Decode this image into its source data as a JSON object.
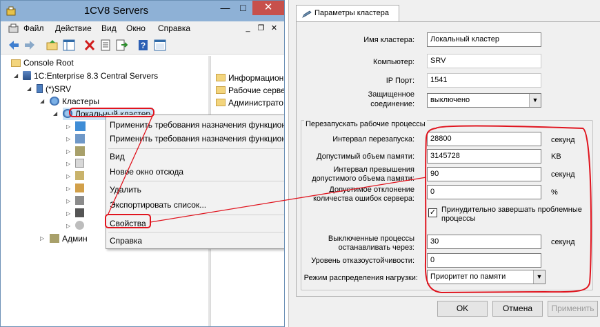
{
  "mmc": {
    "title": "1CV8 Servers",
    "menu": [
      "Файл",
      "Действие",
      "Вид",
      "Окно",
      "Справка"
    ],
    "tree": {
      "root": "Console Root",
      "servers": "1C:Enterprise 8.3 Central Servers",
      "srv": "(*)SRV",
      "clusters": "Кластеры",
      "cluster": "Локальный кластер",
      "admin": "Админ"
    },
    "list_items": [
      "Информацион",
      "Рабочие серве",
      "Администрато"
    ]
  },
  "context_menu": {
    "items": [
      "Применить требования назначения функциона",
      "Применить требования назначения функцион",
      "Вид",
      "Новое окно отсюда",
      "Удалить",
      "Экспортировать список...",
      "Свойства",
      "Справка"
    ]
  },
  "dialog": {
    "tab_label": "Параметры кластера",
    "cluster_name_label": "Имя кластера:",
    "cluster_name": "Локальный кластер",
    "computer_label": "Компьютер:",
    "computer": "SRV",
    "ip_port_label": "IP Порт:",
    "ip_port": "1541",
    "secure_label_1": "Защищенное",
    "secure_label_2": "соединение:",
    "secure_value": "выключено",
    "group_title": "Перезапускать рабочие процессы",
    "restart_interval_label": "Интервал перезапуска:",
    "restart_interval": "28800",
    "restart_interval_unit": "секунд",
    "memory_label": "Допустимый объем памяти:",
    "memory": "3145728",
    "memory_unit": "KB",
    "mem_exceed_label_1": "Интервал превышения",
    "mem_exceed_label_2": "допустимого объема памяти:",
    "mem_exceed": "90",
    "mem_exceed_unit": "секунд",
    "error_dev_label_1": "Допустимое отклонение",
    "error_dev_label_2": "количества ошибок сервера:",
    "error_dev": "0",
    "error_dev_unit": "%",
    "force_close_label_1": "Принудительно завершать проблемные",
    "force_close_label_2": "процессы",
    "force_close_checked": true,
    "stop_label_1": "Выключенные процессы",
    "stop_label_2": "останавливать через:",
    "stop_value": "30",
    "stop_unit": "секунд",
    "fault_label": "Уровень отказоустойчивости:",
    "fault_value": "0",
    "balance_label": "Режим распределения нагрузки:",
    "balance_value": "Приоритет по памяти",
    "ok": "OK",
    "cancel": "Отмена",
    "apply": "Применить"
  },
  "colors": {
    "title_bar": "#8eb1d6",
    "close_button": "#c7504b",
    "annotation": "#e0141e"
  }
}
